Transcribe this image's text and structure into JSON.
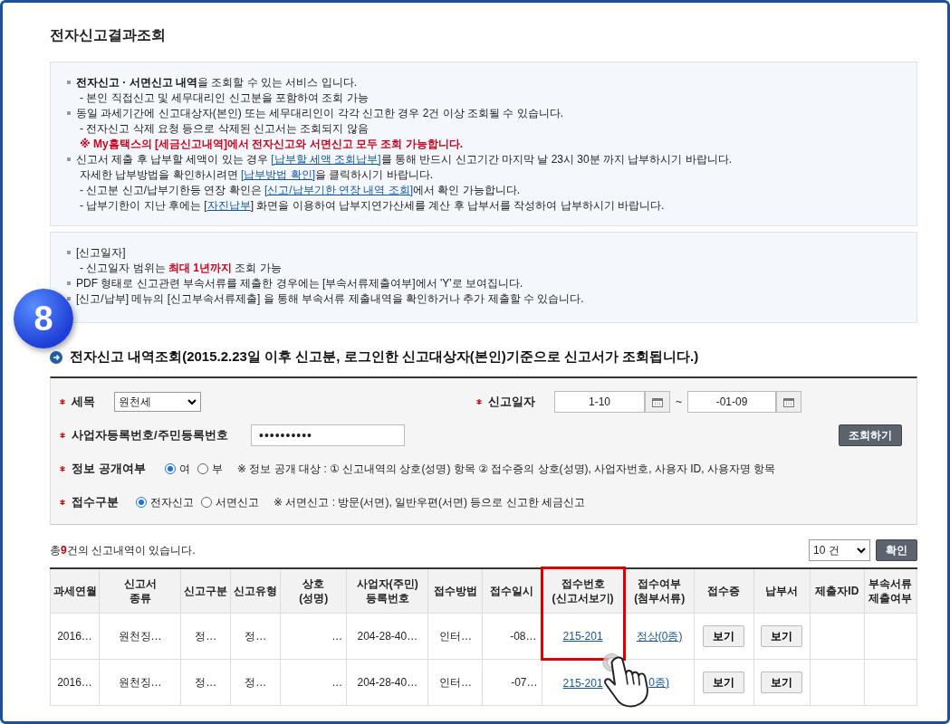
{
  "title": "전자신고결과조회",
  "notice_1": [
    {
      "kind": "bullet",
      "parts": [
        {
          "text": "**전자신고 · 서면신고 내역**을 조회할 수 있는 서비스 입니다."
        }
      ]
    },
    {
      "kind": "sub",
      "parts": [
        {
          "text": "- 본인 직접신고 및 세무대리인 신고분을 포함하여 조회 가능"
        }
      ]
    },
    {
      "kind": "bullet",
      "parts": [
        {
          "text": "동일 과세기간에 신고대상자(본인) 또는 세무대리인이 각각 신고한 경우 2건 이상 조회될 수 있습니다."
        }
      ]
    },
    {
      "kind": "sub",
      "parts": [
        {
          "text": "- 전자신고 삭제 요청 등으로 삭제된 신고서는 조회되지 않음"
        }
      ]
    },
    {
      "kind": "alert",
      "parts": [
        {
          "text": "※ My홈택스의 [세금신고내역]에서 전자신고와 서면신고 모두 조회 가능합니다."
        }
      ]
    },
    {
      "kind": "bullet",
      "parts": [
        {
          "text": "신고서 제출 후 납부할 세액이 있는 경우 "
        },
        {
          "text": "[납부할 세액 조회납부]",
          "link": true
        },
        {
          "text": "를 통해 반드시 신고기간 마지막 날 23시 30분 까지 납부하시기 바랍니다."
        }
      ]
    },
    {
      "kind": "sub",
      "parts": [
        {
          "text": "자세한 납부방법을 확인하시려면 "
        },
        {
          "text": "[납부방법 확인]",
          "link": true
        },
        {
          "text": "을 클릭하시기 바랍니다."
        }
      ]
    },
    {
      "kind": "sub",
      "parts": [
        {
          "text": "- 신고분 신고/납부기한등 연장 확인은 "
        },
        {
          "text": "[신고/납부기한 연장 내역 조회]",
          "link": true
        },
        {
          "text": "에서 확인 가능합니다."
        }
      ]
    },
    {
      "kind": "sub",
      "parts": [
        {
          "text": "- 납부기한이 지난 후에는 ["
        },
        {
          "text": "자진납부",
          "link": true
        },
        {
          "text": "] 화면을 이용하여 납부지연가산세를 계산 후 납부서를 작성하여 납부하시기 바랍니다."
        }
      ]
    }
  ],
  "notice_2": [
    {
      "kind": "bullet",
      "parts": [
        {
          "text": "[신고일자]"
        }
      ]
    },
    {
      "kind": "sub",
      "parts": [
        {
          "text": "- 신고일자 범위는 **최대 1년까지** 조회 가능"
        }
      ]
    },
    {
      "kind": "bullet",
      "parts": [
        {
          "text": "PDF 형태로 신고관련 부속서류를 제출한 경우에는 [부속서류제출여부]에서 'Y'로 보여집니다."
        }
      ]
    },
    {
      "kind": "bullet",
      "parts": [
        {
          "text": "[신고/납부] 메뉴의 [신고부속서류제출] 을 통해 부속서류 제출내역을 확인하거나 추가 제출할 수 있습니다."
        }
      ]
    }
  ],
  "step_badge": "8",
  "section_heading": "전자신고 내역조회(2015.2.23일 이후 신고분, 로그인한  신고대상자(본인)기준으로  신고서가 조회됩니다.)",
  "form": {
    "tax_item": {
      "label": "세목",
      "required": true,
      "value": "원천세"
    },
    "report_date": {
      "label": "신고일자",
      "required": true,
      "from": "1-10",
      "separator": "~",
      "to": "-01-09"
    },
    "id_number": {
      "label": "사업자등록번호/주민등록번호",
      "required": true,
      "value": "••••••••••"
    },
    "search_button": "조회하기",
    "disclosure": {
      "label": "정보 공개여부",
      "required": true,
      "options": [
        {
          "label": "여",
          "selected": true
        },
        {
          "label": "부",
          "selected": false
        }
      ],
      "note": "※ 정보 공개 대상 : ① 신고내역의 상호(성명) 항목 ② 접수증의 상호(성명), 사업자번호, 사용자 ID, 사용자명 항목"
    },
    "receipt_type": {
      "label": "접수구분",
      "required": true,
      "options": [
        {
          "label": "전자신고",
          "selected": true
        },
        {
          "label": "서면신고",
          "selected": false
        }
      ],
      "note": "※ 서면신고 : 방문(서면), 일반우편(서면) 등으로 신고한 세금신고"
    }
  },
  "summary": {
    "before": "총",
    "count": "9",
    "after": "건의 신고내역이 있습니다."
  },
  "page_size": "10 건",
  "confirm_button": "확인",
  "table": {
    "columns": [
      {
        "label": "과세연월",
        "highlighted": false
      },
      {
        "label": "신고서\n종류",
        "highlighted": false
      },
      {
        "label": "신고구분",
        "highlighted": false
      },
      {
        "label": "신고유형",
        "highlighted": false
      },
      {
        "label": "상호\n(성명)",
        "highlighted": false
      },
      {
        "label": "사업자(주민)\n등록번호",
        "highlighted": false
      },
      {
        "label": "접수방법",
        "highlighted": false
      },
      {
        "label": "접수일시",
        "highlighted": false
      },
      {
        "label": "접수번호\n(신고서보기)",
        "highlighted": true
      },
      {
        "label": "접수여부\n(첨부서류)",
        "highlighted": false
      },
      {
        "label": "접수증",
        "highlighted": false
      },
      {
        "label": "납부서",
        "highlighted": false
      },
      {
        "label": "제출자ID",
        "highlighted": false
      },
      {
        "label": "부속서류\n제출여부",
        "highlighted": false
      }
    ],
    "rows": [
      {
        "cells": [
          {
            "kind": "text",
            "text": "2016…"
          },
          {
            "kind": "text",
            "text": "원천징…"
          },
          {
            "kind": "text",
            "text": "정…"
          },
          {
            "kind": "text",
            "text": "정…"
          },
          {
            "kind": "text",
            "text": "…"
          },
          {
            "kind": "text",
            "text": "204-28-40…"
          },
          {
            "kind": "text",
            "text": "인터…"
          },
          {
            "kind": "text",
            "text": "-08…"
          },
          {
            "kind": "link",
            "text": "215-201"
          },
          {
            "kind": "link",
            "text": "정상(0종)"
          },
          {
            "kind": "button",
            "text": "보기"
          },
          {
            "kind": "button",
            "text": "보기"
          },
          {
            "kind": "empty"
          },
          {
            "kind": "empty"
          }
        ]
      },
      {
        "cells": [
          {
            "kind": "text",
            "text": "2016…"
          },
          {
            "kind": "text",
            "text": "원천징…"
          },
          {
            "kind": "text",
            "text": "정…"
          },
          {
            "kind": "text",
            "text": "정…"
          },
          {
            "kind": "text",
            "text": "…"
          },
          {
            "kind": "text",
            "text": "204-28-40…"
          },
          {
            "kind": "text",
            "text": "인터…"
          },
          {
            "kind": "text",
            "text": "-07…"
          },
          {
            "kind": "link",
            "text": "215-201"
          },
          {
            "kind": "link",
            "text": "0종)"
          },
          {
            "kind": "button",
            "text": "보기"
          },
          {
            "kind": "button",
            "text": "보기"
          },
          {
            "kind": "empty"
          },
          {
            "kind": "empty"
          }
        ]
      }
    ]
  }
}
